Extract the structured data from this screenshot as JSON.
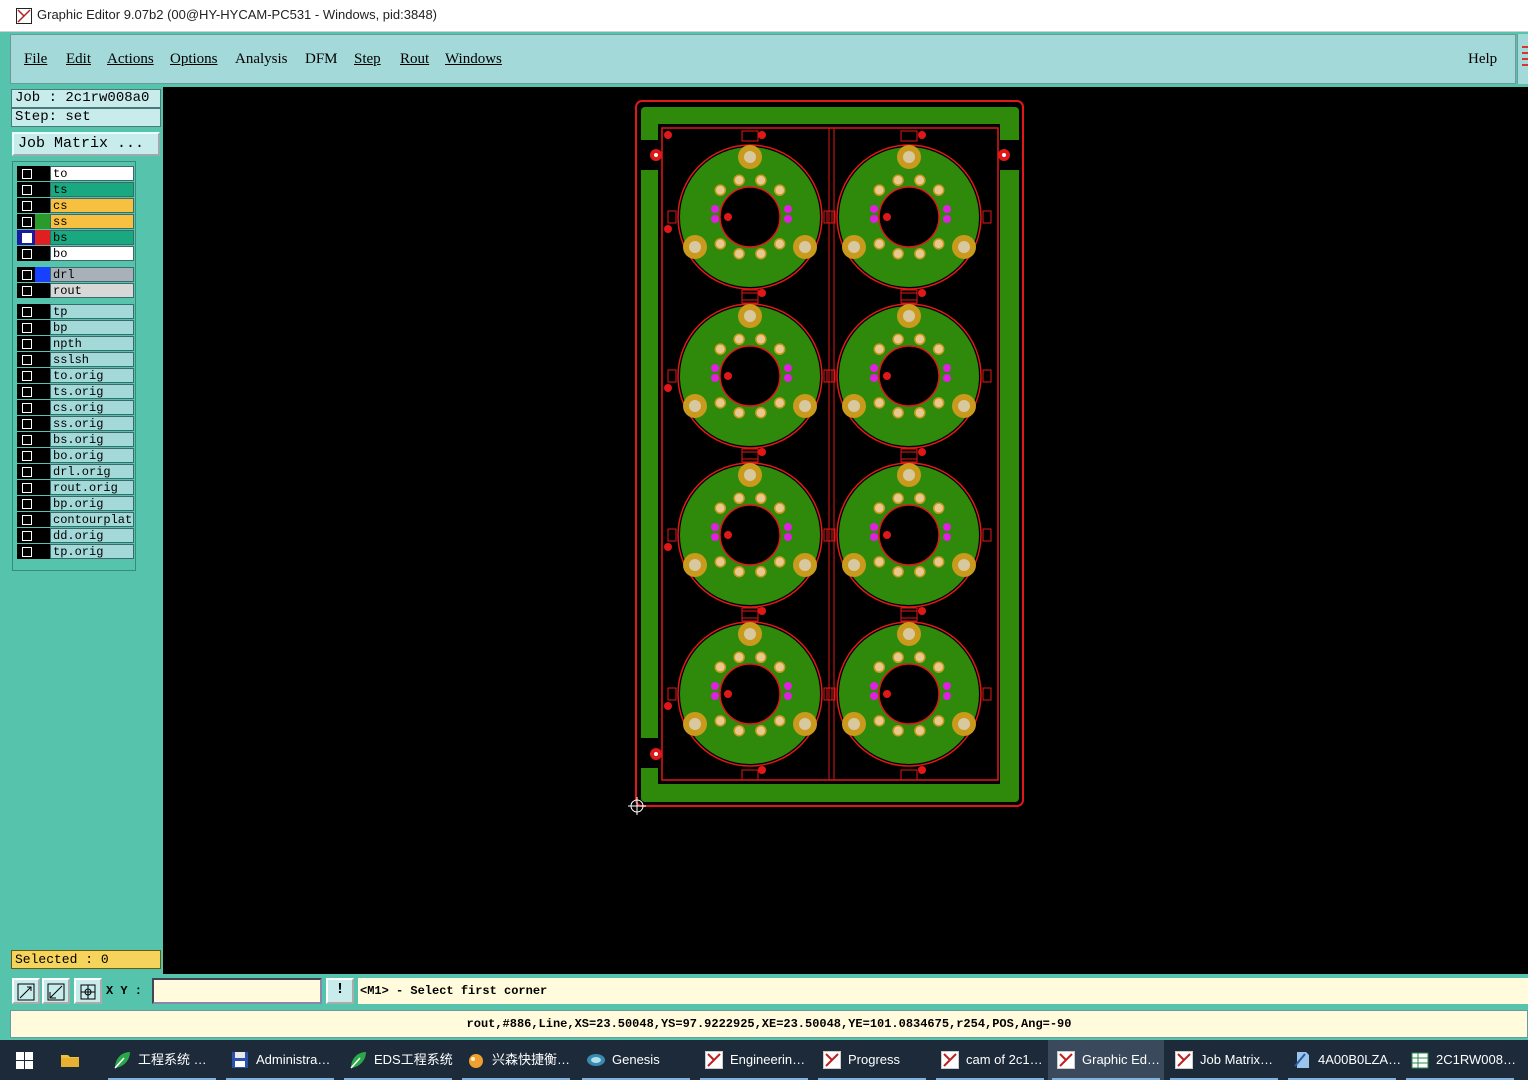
{
  "window": {
    "title": "Graphic Editor 9.07b2 (00@HY-HYCAM-PC531 - Windows, pid:3848)"
  },
  "menu": {
    "items": [
      {
        "label": "File",
        "underline": true
      },
      {
        "label": "Edit",
        "underline": true
      },
      {
        "label": "Actions",
        "underline": true
      },
      {
        "label": "Options",
        "underline": true
      },
      {
        "label": "Analysis",
        "underline": false
      },
      {
        "label": "DFM",
        "underline": false
      },
      {
        "label": "Step",
        "underline": true
      },
      {
        "label": "Rout",
        "underline": true
      },
      {
        "label": "Windows",
        "underline": true
      }
    ],
    "help": "Help"
  },
  "left": {
    "job": "Job : 2c1rw008a0",
    "step": "Step: set",
    "job_matrix": "Job Matrix ...",
    "selected": "Selected : 0"
  },
  "layers": [
    {
      "name": "to",
      "swatch": "#000000",
      "bg": "#ffffff",
      "checked": false
    },
    {
      "name": "ts",
      "swatch": "#000000",
      "bg": "#1aa880",
      "checked": false
    },
    {
      "name": "cs",
      "swatch": "#000000",
      "bg": "#f8c040",
      "checked": false
    },
    {
      "name": "ss",
      "swatch": "#2a9a2a",
      "bg": "#f8c040",
      "checked": false
    },
    {
      "name": "bs",
      "swatch": "#e02020",
      "bg": "#1aa880",
      "checked": true
    },
    {
      "name": "bo",
      "swatch": "#000000",
      "bg": "#ffffff",
      "checked": false
    },
    {
      "name": "drl",
      "swatch": "#1840ff",
      "bg": "#a8b0b8",
      "checked": false
    },
    {
      "name": "rout",
      "swatch": "#000000",
      "bg": "#d8d8d8",
      "checked": false
    },
    {
      "name": "tp",
      "swatch": "#000000",
      "bg": "#a4d9d9",
      "checked": false
    },
    {
      "name": "bp",
      "swatch": "#000000",
      "bg": "#a4d9d9",
      "checked": false
    },
    {
      "name": "npth",
      "swatch": "#000000",
      "bg": "#a4d9d9",
      "checked": false
    },
    {
      "name": "sslsh",
      "swatch": "#000000",
      "bg": "#a4d9d9",
      "checked": false
    },
    {
      "name": "to.orig",
      "swatch": "#000000",
      "bg": "#a4d9d9",
      "checked": false
    },
    {
      "name": "ts.orig",
      "swatch": "#000000",
      "bg": "#a4d9d9",
      "checked": false
    },
    {
      "name": "cs.orig",
      "swatch": "#000000",
      "bg": "#a4d9d9",
      "checked": false
    },
    {
      "name": "ss.orig",
      "swatch": "#000000",
      "bg": "#a4d9d9",
      "checked": false
    },
    {
      "name": "bs.orig",
      "swatch": "#000000",
      "bg": "#a4d9d9",
      "checked": false
    },
    {
      "name": "bo.orig",
      "swatch": "#000000",
      "bg": "#a4d9d9",
      "checked": false
    },
    {
      "name": "drl.orig",
      "swatch": "#000000",
      "bg": "#a4d9d9",
      "checked": false
    },
    {
      "name": "rout.orig",
      "swatch": "#000000",
      "bg": "#a4d9d9",
      "checked": false
    },
    {
      "name": "bp.orig",
      "swatch": "#000000",
      "bg": "#a4d9d9",
      "checked": false
    },
    {
      "name": "contourplate",
      "swatch": "#000000",
      "bg": "#a4d9d9",
      "checked": false
    },
    {
      "name": "dd.orig",
      "swatch": "#000000",
      "bg": "#a4d9d9",
      "checked": false
    },
    {
      "name": "tp.orig",
      "swatch": "#000000",
      "bg": "#a4d9d9",
      "checked": false
    }
  ],
  "input": {
    "xy_label": "X Y :",
    "xy_value": "",
    "info_button": "!",
    "prompt": "<M1> - Select first corner"
  },
  "status": "rout,#886,Line,XS=23.50048,YS=97.9222925,XE=23.50048,YE=101.0834675,r254,POS,Ang=-90",
  "colors": {
    "panel_teal": "#56c4ad",
    "menu_bg": "#a4d9d9",
    "board_green": "#2f8a0c",
    "pad_gold": "#c99a1c",
    "rout_red": "#e01818",
    "via_magenta": "#e020e0"
  },
  "taskbar": [
    {
      "label": "工程系统 …",
      "icon": "green-leaf-icon",
      "active": false
    },
    {
      "label": "Administra…",
      "icon": "floppy-disk-icon",
      "active": false
    },
    {
      "label": "EDS工程系统",
      "icon": "green-leaf-icon",
      "active": false
    },
    {
      "label": "兴森快捷衡…",
      "icon": "sun-ball-icon",
      "active": false
    },
    {
      "label": "Genesis",
      "icon": "genesis-icon",
      "active": false
    },
    {
      "label": "Engineerin…",
      "icon": "x-window-icon",
      "active": false
    },
    {
      "label": "Progress",
      "icon": "x-window-icon",
      "active": false
    },
    {
      "label": "cam of 2c1…",
      "icon": "x-window-icon",
      "active": false
    },
    {
      "label": "Graphic Ed…",
      "icon": "x-window-icon",
      "active": true
    },
    {
      "label": "Job Matrix…",
      "icon": "x-window-icon",
      "active": false
    },
    {
      "label": "4A00B0LZA…",
      "icon": "document-icon",
      "active": false
    },
    {
      "label": "2C1RW008…",
      "icon": "spreadsheet-icon",
      "active": false
    }
  ]
}
